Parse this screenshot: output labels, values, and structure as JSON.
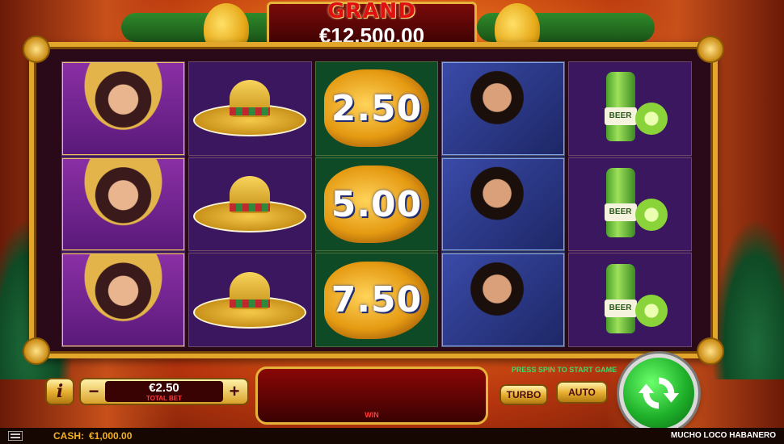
{
  "jackpot": {
    "label": "GRAND",
    "value": "€12,500.00"
  },
  "reels": [
    {
      "theme": "purple",
      "symbols": [
        "woman",
        "woman",
        "woman"
      ]
    },
    {
      "theme": "purple",
      "symbols": [
        "sombrero",
        "sombrero",
        "sombrero"
      ]
    },
    {
      "theme": "green",
      "symbols": [
        "pepper",
        "pepper",
        "pepper"
      ],
      "values": [
        "2.50",
        "5.00",
        "7.50"
      ]
    },
    {
      "theme": "blue",
      "symbols": [
        "man",
        "man",
        "man"
      ]
    },
    {
      "theme": "purple",
      "symbols": [
        "beer",
        "beer",
        "beer"
      ],
      "beer_label": "BEER"
    }
  ],
  "controls": {
    "info_label": "i",
    "minus_label": "−",
    "plus_label": "+",
    "bet_value": "€2.50",
    "bet_label": "TOTAL BET",
    "win_label": "WIN",
    "hint": "PRESS SPIN TO START GAME",
    "turbo_label": "TURBO",
    "auto_label": "AUTO"
  },
  "status": {
    "cash_label": "CASH:",
    "cash_value": "€1,000.00",
    "game_name": "MUCHO LOCO HABANERO"
  },
  "colors": {
    "gold": "#e6b23a",
    "spin_green": "#1fb02a",
    "jackpot_red": "#e01010"
  }
}
